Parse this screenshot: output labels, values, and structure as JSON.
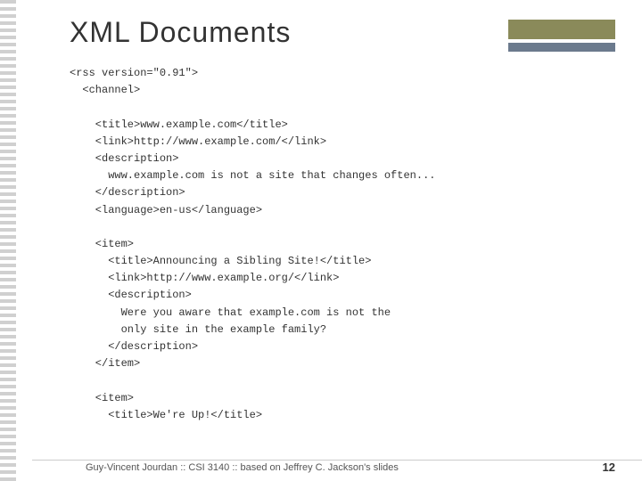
{
  "slide": {
    "title": "XML Documents",
    "code_lines": [
      "<rss version=\"0.91\">",
      "  <channel>",
      "",
      "    <title>www.example.com</title>",
      "    <link>http://www.example.com/</link>",
      "    <description>",
      "      www.example.com is not a site that changes often...",
      "    </description>",
      "    <language>en-us</language>",
      "",
      "    <item>",
      "      <title>Announcing a Sibling Site!</title>",
      "      <link>http://www.example.org/</link>",
      "      <description>",
      "        Were you aware that example.com is not the",
      "        only site in the example family?",
      "      </description>",
      "    </item>",
      "",
      "    <item>",
      "      <title>We're Up!</title>"
    ],
    "footer": {
      "author": "Guy-Vincent Jourdan",
      "separator1": "::",
      "course": "CSI 3140",
      "separator2": "::",
      "credit": "based on Jeffrey C. Jackson's slides",
      "page_number": "12"
    }
  }
}
